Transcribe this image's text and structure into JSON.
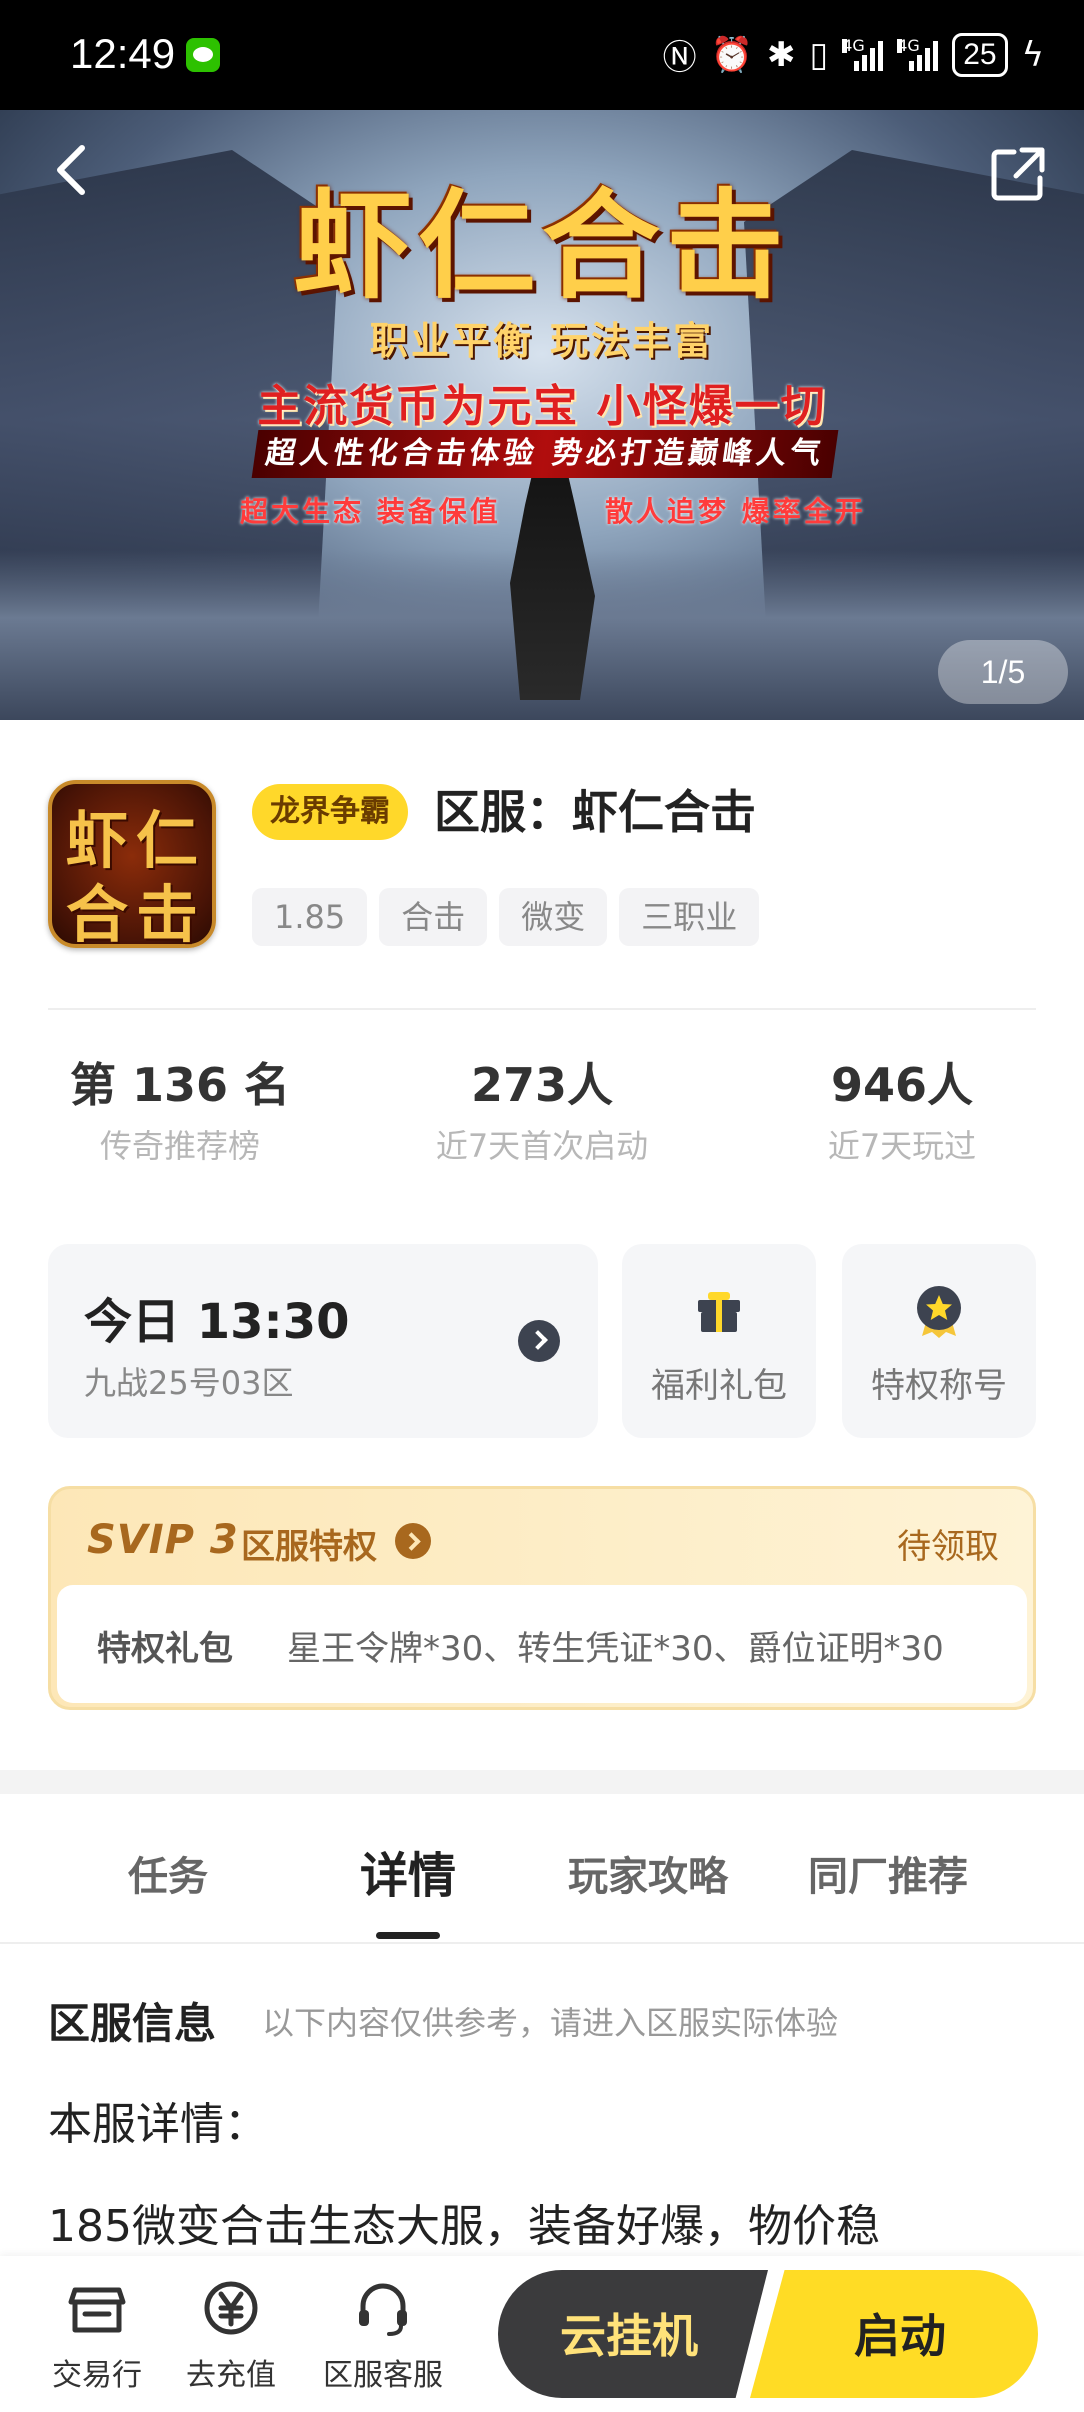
{
  "status_bar": {
    "time": "12:49",
    "battery": "25",
    "network_1": "4G",
    "network_2": "4G"
  },
  "banner": {
    "title": "虾仁合击",
    "line1": "职业平衡  玩法丰富",
    "line2": "主流货币为元宝  小怪爆一切",
    "line3": "超人性化合击体验  势必打造巅峰人气",
    "line4_left": "超大生态  装备保值",
    "line4_right": "散人追梦  爆率全开",
    "pager": "1/5"
  },
  "game": {
    "icon_text": [
      "虾",
      "仁",
      "合",
      "击"
    ],
    "category_tag": "龙界争霸",
    "title": "区服：虾仁合击",
    "chips": [
      "1.85",
      "合击",
      "微变",
      "三职业"
    ]
  },
  "stats": [
    {
      "value": "第 136 名",
      "label": "传奇推荐榜"
    },
    {
      "value": "273人",
      "label": "近7天首次启动"
    },
    {
      "value": "946人",
      "label": "近7天玩过"
    }
  ],
  "server_card": {
    "time": "今日 13:30",
    "server": "九战25号03区"
  },
  "quick_cards": [
    {
      "label": "福利礼包",
      "icon": "gift-icon"
    },
    {
      "label": "特权称号",
      "icon": "medal-icon"
    }
  ],
  "svip": {
    "logo": "SVIP 3",
    "heading": "区服特权",
    "status": "待领取",
    "gift_key": "特权礼包",
    "gift_value": "星王令牌*30、转生凭证*30、爵位证明*30"
  },
  "tabs": [
    "任务",
    "详情",
    "玩家攻略",
    "同厂推荐"
  ],
  "active_tab": "详情",
  "detail": {
    "section_title": "区服信息",
    "section_note": "以下内容仅供参考，请进入区服实际体验",
    "paragraph_1": "本服详情：",
    "paragraph_2": "185微变合击生态大服，装备好爆，物价稳"
  },
  "bottom_bar": {
    "items": [
      {
        "label": "交易行",
        "icon": "store-icon"
      },
      {
        "label": "去充值",
        "icon": "yuan-coin-icon"
      },
      {
        "label": "区服客服",
        "icon": "headset-icon"
      }
    ],
    "cloud_button": "云挂机",
    "start_button": "启动"
  },
  "colors": {
    "accent_yellow": "#ffdc25",
    "svip_brown": "#a8681e",
    "dark_button": "#3b3b3d"
  }
}
